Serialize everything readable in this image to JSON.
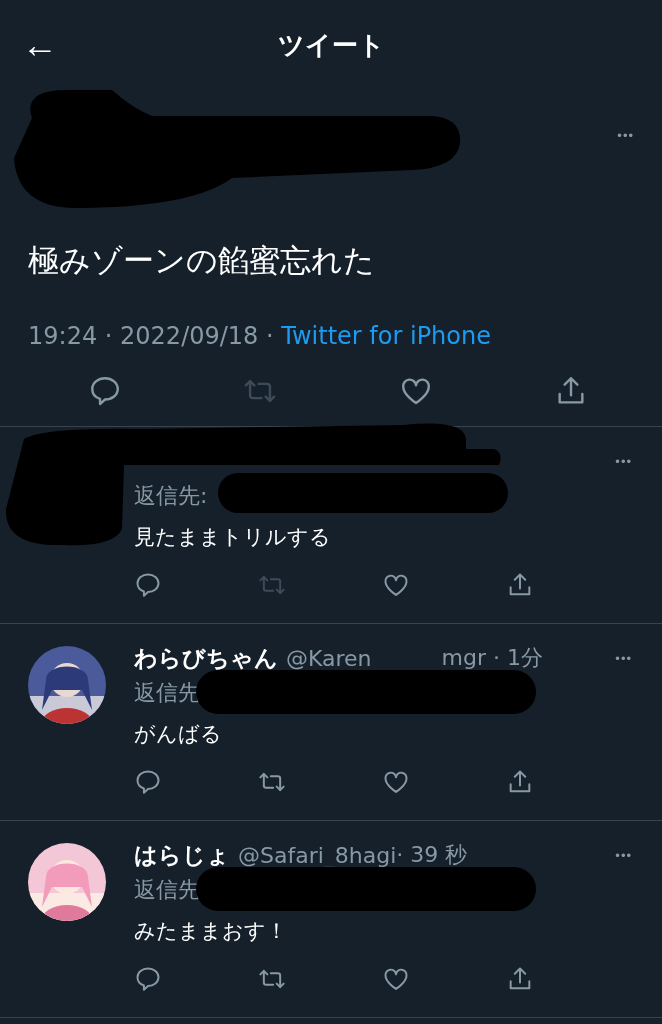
{
  "header": {
    "back": "←",
    "title": "ツイート"
  },
  "main_tweet": {
    "author_redacted": true,
    "more": "•••",
    "text": "極みゾーンの餡蜜忘れた",
    "time": "19:24 · 2022/09/18 · ",
    "source": "Twitter for iPhone",
    "retweet_disabled": true
  },
  "replies": [
    {
      "author_redacted": true,
      "reply_label": "返信先:",
      "reply_to_redacted": true,
      "text": "見たままトリルする",
      "more": "•••",
      "retweet_disabled": true
    },
    {
      "name": "わらびちゃん",
      "handle": "@Karen",
      "handle_tail": "mgr · 1分",
      "handle_redacted": true,
      "reply_label": "返信先",
      "reply_to_redacted": true,
      "text": "がんばる",
      "more": "•••",
      "retweet_disabled": false
    },
    {
      "name": "はらじょ",
      "handle": "@Safari_8hagi",
      "handle_tail": "· 39 秒",
      "handle_redacted": false,
      "reply_label": "返信先",
      "reply_to_redacted": true,
      "text": "みたままおす！",
      "more": "•••",
      "retweet_disabled": false
    }
  ]
}
